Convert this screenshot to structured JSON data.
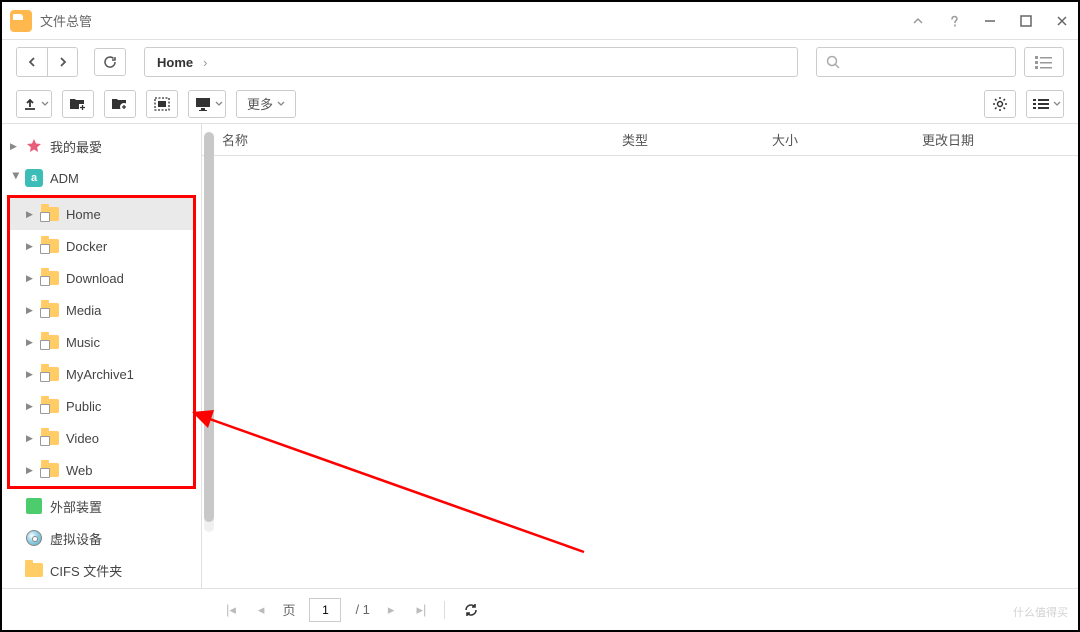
{
  "window": {
    "title": "文件总管"
  },
  "breadcrumb": {
    "current": "Home"
  },
  "toolbar": {
    "more_label": "更多"
  },
  "sidebar": {
    "favorites_label": "我的最愛",
    "adm_label": "ADM",
    "adm_children": [
      {
        "label": "Home"
      },
      {
        "label": "Docker"
      },
      {
        "label": "Download"
      },
      {
        "label": "Media"
      },
      {
        "label": "Music"
      },
      {
        "label": "MyArchive1"
      },
      {
        "label": "Public"
      },
      {
        "label": "Video"
      },
      {
        "label": "Web"
      }
    ],
    "external_label": "外部装置",
    "virtual_label": "虚拟设备",
    "cifs_label": "CIFS 文件夹"
  },
  "columns": {
    "name": "名称",
    "type": "类型",
    "size": "大小",
    "modified": "更改日期"
  },
  "pagination": {
    "page_label": "页",
    "current": "1",
    "total": "/ 1"
  },
  "watermark": "什么值得买"
}
